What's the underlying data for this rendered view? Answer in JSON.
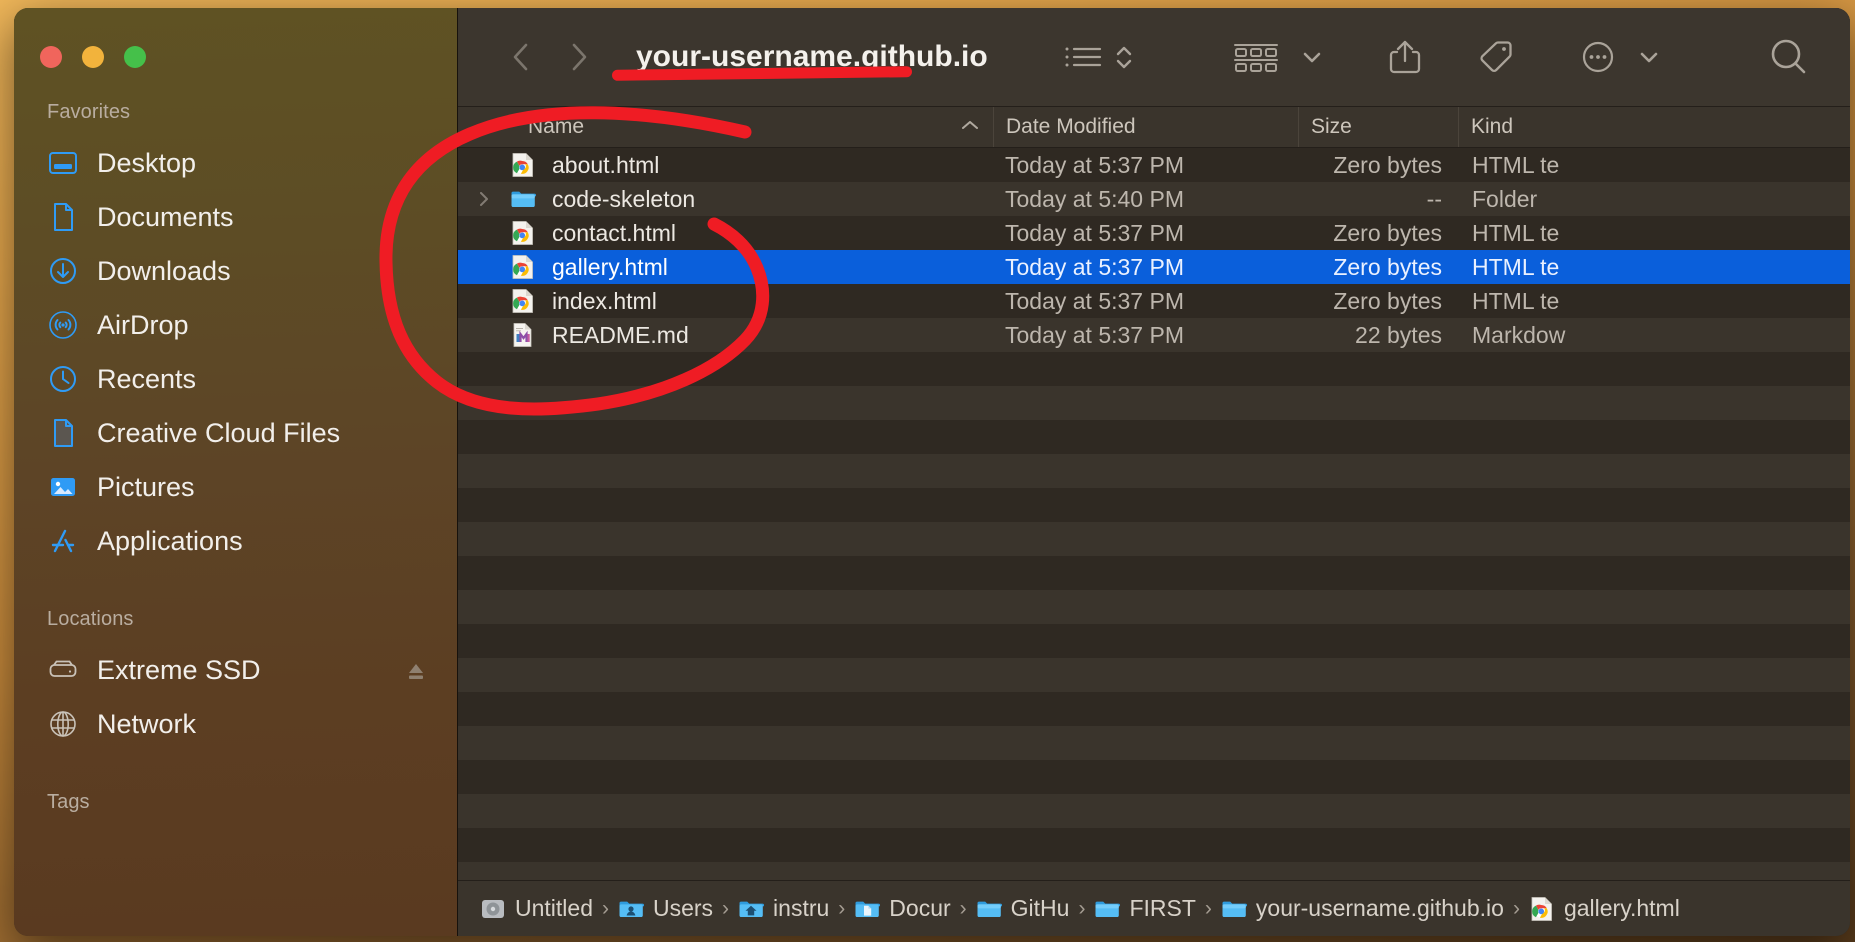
{
  "window": {
    "title": "your-username.github.io",
    "traffic_lights": [
      "close-red",
      "minimize-yellow",
      "maximize-green"
    ]
  },
  "sidebar": {
    "sections": [
      {
        "label": "Favorites",
        "items": [
          {
            "label": "Desktop",
            "icon": "desktop-icon"
          },
          {
            "label": "Documents",
            "icon": "document-icon"
          },
          {
            "label": "Downloads",
            "icon": "download-icon"
          },
          {
            "label": "AirDrop",
            "icon": "airdrop-icon"
          },
          {
            "label": "Recents",
            "icon": "clock-icon"
          },
          {
            "label": "Creative Cloud Files",
            "icon": "document-gray-icon"
          },
          {
            "label": "Pictures",
            "icon": "pictures-icon"
          },
          {
            "label": "Applications",
            "icon": "applications-icon"
          }
        ]
      },
      {
        "label": "Locations",
        "items": [
          {
            "label": "Extreme SSD",
            "icon": "external-drive-icon",
            "eject": "eject-icon"
          },
          {
            "label": "Network",
            "icon": "globe-icon"
          }
        ]
      },
      {
        "label": "Tags",
        "items": []
      }
    ]
  },
  "toolbar": {
    "back_label": "Back",
    "forward_label": "Forward",
    "icons": [
      "list-view-icon",
      "sort-chevrons-icon",
      "group-by-icon",
      "chevron-down-icon",
      "share-icon",
      "tag-icon",
      "more-options-icon",
      "chevron-down-icon",
      "search-icon"
    ]
  },
  "columns": {
    "name": "Name",
    "date_modified": "Date Modified",
    "size": "Size",
    "kind": "Kind",
    "sort_indicator": "ascending"
  },
  "files": [
    {
      "name": "about.html",
      "date": "Today at 5:37 PM",
      "size": "Zero bytes",
      "kind": "HTML te",
      "icon": "chrome-html-icon",
      "disclosure": false,
      "selected": false
    },
    {
      "name": "code-skeleton",
      "date": "Today at 5:40 PM",
      "size": "--",
      "kind": "Folder",
      "icon": "folder-icon",
      "disclosure": true,
      "selected": false
    },
    {
      "name": "contact.html",
      "date": "Today at 5:37 PM",
      "size": "Zero bytes",
      "kind": "HTML te",
      "icon": "chrome-html-icon",
      "disclosure": false,
      "selected": false
    },
    {
      "name": "gallery.html",
      "date": "Today at 5:37 PM",
      "size": "Zero bytes",
      "kind": "HTML te",
      "icon": "chrome-html-icon",
      "disclosure": false,
      "selected": true
    },
    {
      "name": "index.html",
      "date": "Today at 5:37 PM",
      "size": "Zero bytes",
      "kind": "HTML te",
      "icon": "chrome-html-icon",
      "disclosure": false,
      "selected": false
    },
    {
      "name": "README.md",
      "date": "Today at 5:37 PM",
      "size": "22 bytes",
      "kind": "Markdow",
      "icon": "markdown-doc-icon",
      "disclosure": false,
      "selected": false
    }
  ],
  "pathbar": {
    "crumbs": [
      {
        "label": "Untitled",
        "icon": "hard-drive-icon"
      },
      {
        "label": "Users",
        "icon": "users-folder-icon"
      },
      {
        "label": "instru",
        "icon": "home-folder-icon"
      },
      {
        "label": "Docur",
        "icon": "documents-folder-icon"
      },
      {
        "label": "GitHu",
        "icon": "folder-icon"
      },
      {
        "label": "FIRST",
        "icon": "folder-icon"
      },
      {
        "label": "your-username.github.io",
        "icon": "folder-icon"
      },
      {
        "label": "gallery.html",
        "icon": "chrome-html-icon"
      }
    ],
    "separator": "›"
  },
  "annotations": {
    "circle_color": "#ef1c24",
    "underline_color": "#ef1c24",
    "circle_target": "file list name column",
    "underline_target": "your-username.github.io"
  }
}
